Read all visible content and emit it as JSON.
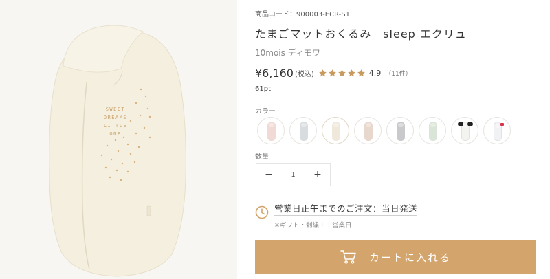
{
  "product": {
    "sku_label": "商品コード：",
    "sku_value": "900003-ECR-S1",
    "title": "たまごマットおくるみ　sleep エクリュ",
    "brand": "10mois ディモワ",
    "price": "¥6,160",
    "tax_note": "(税込)",
    "rating": "4.9",
    "rating_stars": 5,
    "review_count": "（11件）",
    "points": "61pt"
  },
  "image": {
    "print_lines": [
      "SWEET",
      "DREAMS",
      "LITTLE",
      "ONE"
    ]
  },
  "color_section": {
    "label": "カラー",
    "swatches": [
      {
        "name": "pink",
        "color": "#f1d9d6"
      },
      {
        "name": "gray-blue",
        "color": "#d9dcde"
      },
      {
        "name": "ecru",
        "color": "#efe8db"
      },
      {
        "name": "mocha",
        "color": "#e8d7cc"
      },
      {
        "name": "gray",
        "color": "#c9c9cb"
      },
      {
        "name": "mint",
        "color": "#d9e5d6"
      },
      {
        "name": "panda",
        "color": "#f3f3f0"
      },
      {
        "name": "white-bow",
        "color": "#f1f2f4"
      }
    ]
  },
  "quantity": {
    "label": "数量",
    "value": "1",
    "minus": "−",
    "plus": "+"
  },
  "delivery": {
    "main": "営業日正午までのご注文：当日発送",
    "sub": "※ギフト・刺繍＋１営業日"
  },
  "cart": {
    "label": "カートに入れる"
  },
  "colors": {
    "accent": "#d3a46b",
    "star": "#c79a5e"
  }
}
